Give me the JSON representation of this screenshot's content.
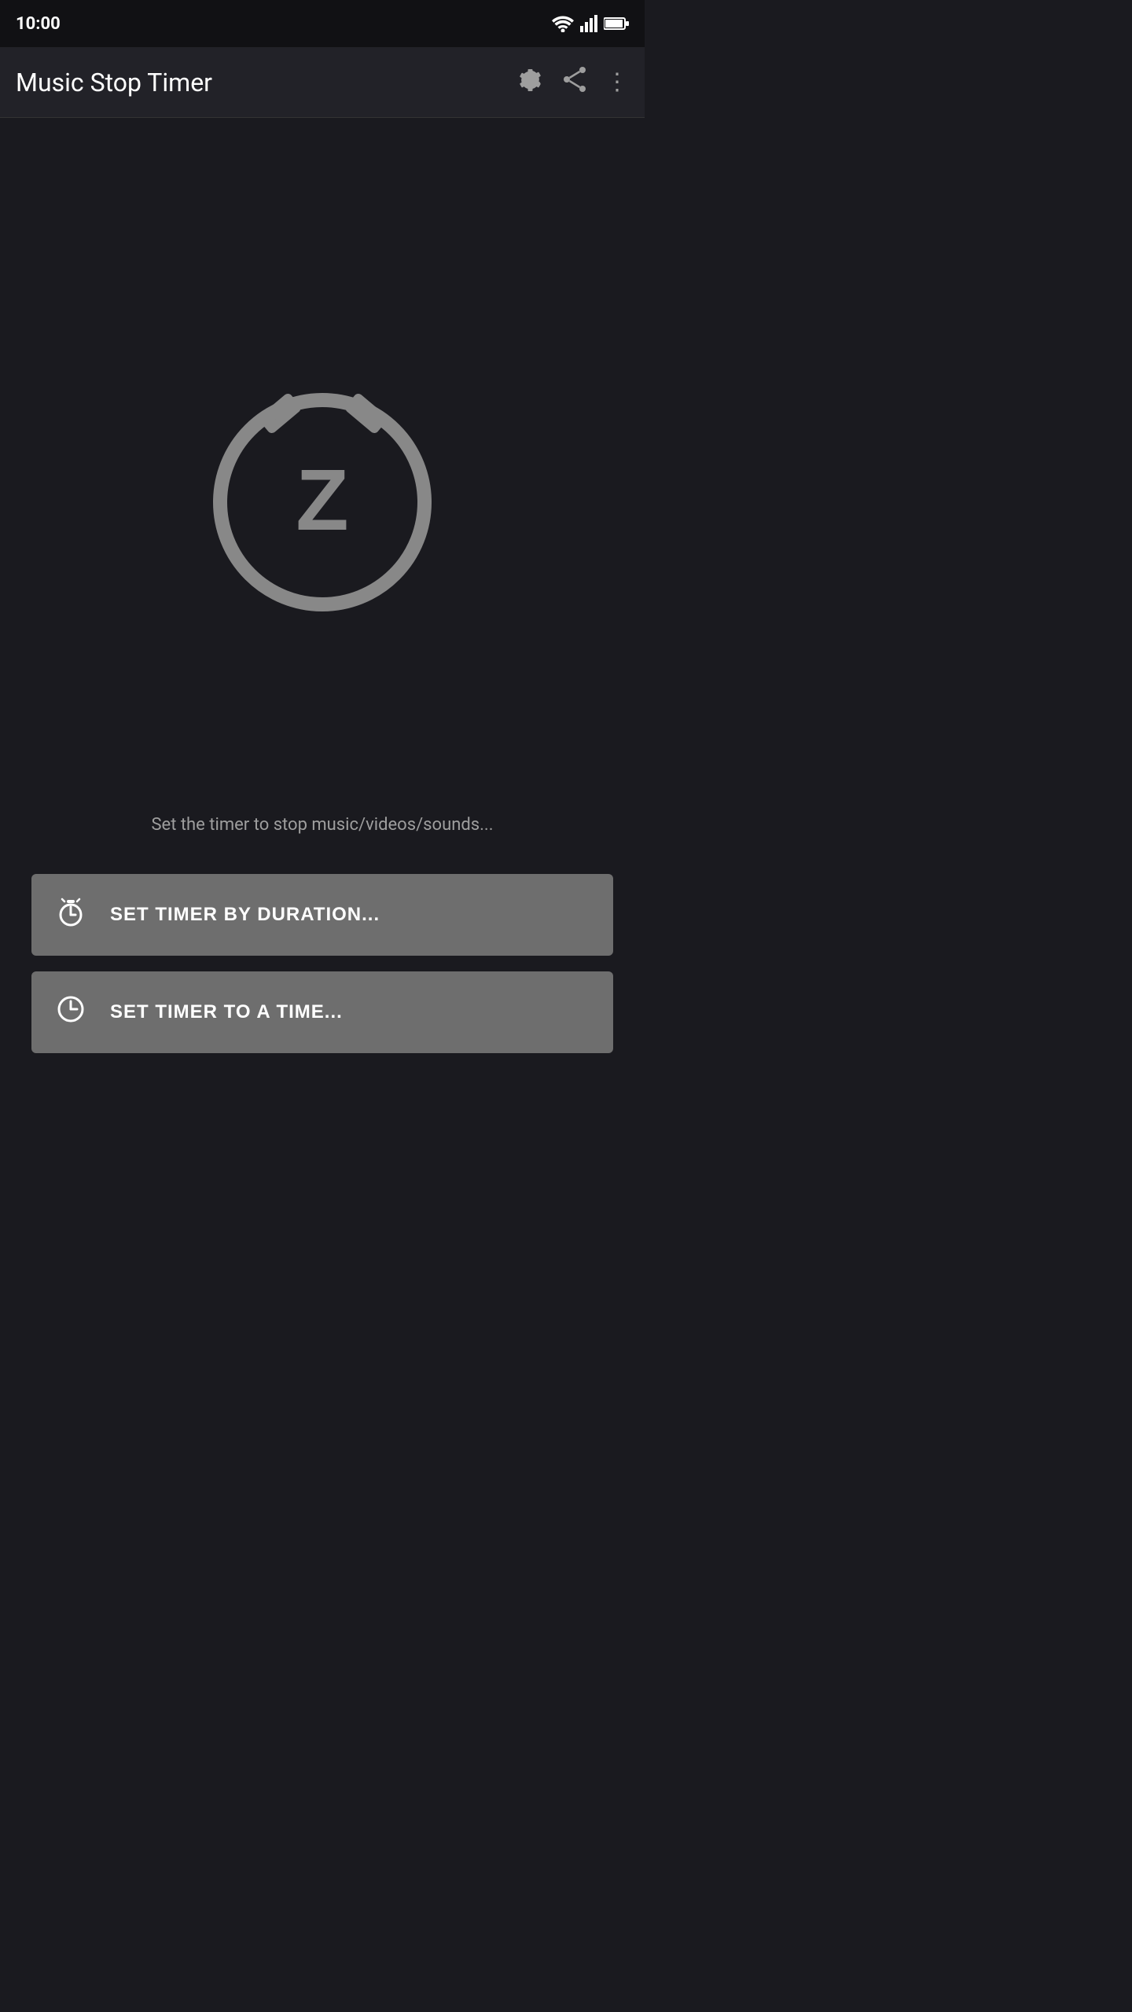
{
  "app": {
    "title": "Music Stop Timer"
  },
  "status_bar": {
    "time": "10:00"
  },
  "toolbar": {
    "title": "Music Stop Timer",
    "settings_icon": "⚙",
    "share_icon": "share",
    "more_icon": "⋮"
  },
  "main": {
    "description": "Set the timer to stop music/videos/sounds...",
    "button_duration_label": "SET TIMER BY DURATION...",
    "button_time_label": "SET TIMER TO A TIME..."
  },
  "colors": {
    "background": "#1a1a1f",
    "toolbar_bg": "#222228",
    "button_bg": "#6e6e6e",
    "icon_color": "#9e9e9e",
    "text_color": "#ffffff"
  }
}
